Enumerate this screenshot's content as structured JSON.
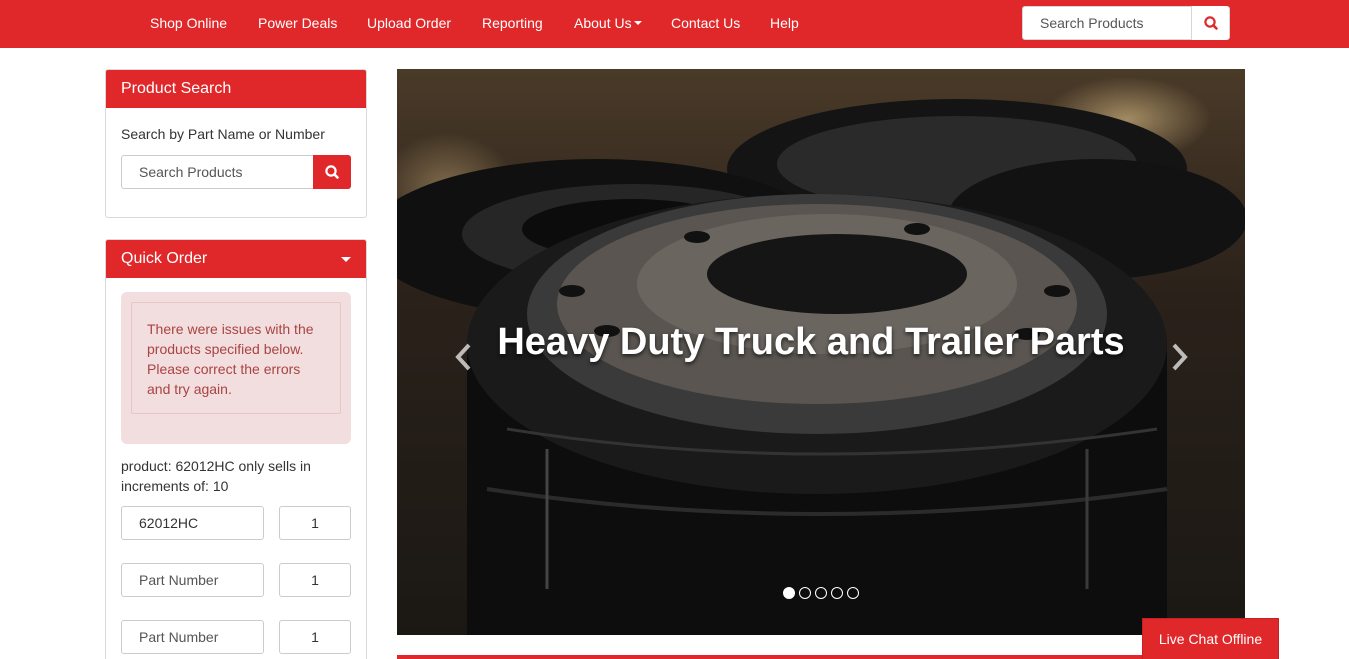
{
  "nav": {
    "items": [
      {
        "label": "Shop Online"
      },
      {
        "label": "Power Deals"
      },
      {
        "label": "Upload Order"
      },
      {
        "label": "Reporting"
      },
      {
        "label": "About Us",
        "has_dropdown": true
      },
      {
        "label": "Contact Us"
      },
      {
        "label": "Help"
      }
    ],
    "search_placeholder": "Search Products",
    "search_icon": "search-icon"
  },
  "product_search": {
    "title": "Product Search",
    "label": "Search by Part Name or Number",
    "placeholder": "Search Products",
    "search_icon": "search-icon"
  },
  "quick_order": {
    "title": "Quick Order",
    "toggle_icon": "caret-down-icon",
    "alert": "There were issues with the products specified below. Please correct the errors and try again.",
    "error_note": "product: 62012HC only sells in increments of: 10",
    "rows": [
      {
        "part_value": "62012HC",
        "part_placeholder": "Part Number",
        "qty": "1"
      },
      {
        "part_value": "",
        "part_placeholder": "Part Number",
        "qty": "1"
      },
      {
        "part_value": "",
        "part_placeholder": "Part Number",
        "qty": "1"
      }
    ]
  },
  "carousel": {
    "caption": "Heavy Duty Truck and Trailer Parts",
    "prev_icon": "chevron-left-icon",
    "next_icon": "chevron-right-icon",
    "slide_count": 5,
    "active_index": 0
  },
  "live_chat": {
    "label": "Live Chat Offline"
  },
  "colors": {
    "brand_red": "#e0282a",
    "alert_bg": "#f2dede",
    "alert_text": "#a94442"
  }
}
